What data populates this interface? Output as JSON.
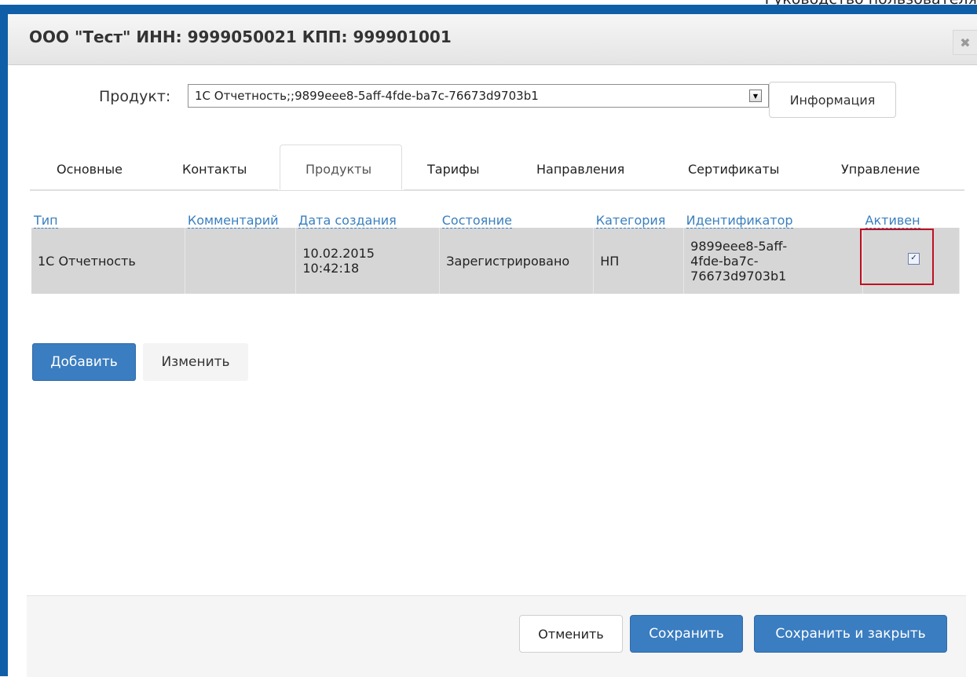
{
  "document_header": "Руководство пользователя",
  "dialog": {
    "title": "ООО \"Тест\" ИНН: 9999050021 КПП: 999901001",
    "close_icon": "close-icon"
  },
  "product": {
    "label": "Продукт:",
    "selected": "1С Отчетность;;9899eee8-5aff-4fde-ba7c-76673d9703b1",
    "info_button": "Информация"
  },
  "tabs": [
    {
      "label": "Основные"
    },
    {
      "label": "Контакты"
    },
    {
      "label": "Продукты",
      "active": true
    },
    {
      "label": "Тарифы"
    },
    {
      "label": "Направления"
    },
    {
      "label": "Сертификаты"
    },
    {
      "label": "Управление"
    }
  ],
  "table": {
    "columns": [
      "Тип",
      "Комментарий",
      "Дата создания",
      "Состояние",
      "Категория",
      "Идентификатор",
      "Активен"
    ],
    "rows": [
      {
        "type": "1С Отчетность",
        "comment": "",
        "created_date": "10.02.2015",
        "created_time": "10:42:18",
        "state": "Зарегистрировано",
        "category": "НП",
        "id_line1": "9899eee8-5aff-",
        "id_line2": "4fde-ba7c-",
        "id_line3": "76673d9703b1",
        "active": true,
        "active_mark": "✓"
      }
    ]
  },
  "actions": {
    "add": "Добавить",
    "edit": "Изменить"
  },
  "footer": {
    "cancel": "Отменить",
    "save": "Сохранить",
    "save_close": "Сохранить и закрыть"
  },
  "colors": {
    "frame_blue": "#0f5fa8",
    "primary_button": "#3a7dc0",
    "link": "#3a7fbf",
    "highlight_red": "#c01020"
  }
}
